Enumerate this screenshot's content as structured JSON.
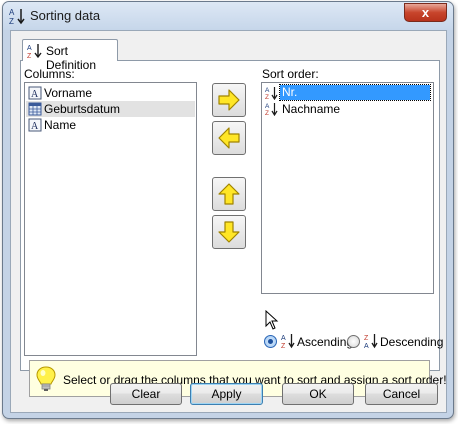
{
  "window": {
    "title": "Sorting data",
    "close_glyph": "x"
  },
  "tab": {
    "label": "Sort Definition"
  },
  "columns": {
    "label": "Columns:",
    "items": [
      {
        "label": "Vorname",
        "icon": "text-field-icon"
      },
      {
        "label": "Geburtsdatum",
        "icon": "date-field-icon"
      },
      {
        "label": "Name",
        "icon": "text-field-icon"
      }
    ]
  },
  "sort_order": {
    "label": "Sort order:",
    "items": [
      {
        "label": "Nr.",
        "icon": "sort-ascending-icon",
        "selected": true
      },
      {
        "label": "Nachname",
        "icon": "sort-ascending-icon",
        "selected": false
      }
    ]
  },
  "direction": {
    "ascending_label": "Ascending",
    "descending_label": "Descending",
    "selected": "Ascending"
  },
  "hint": {
    "text": "Select or drag the columns that you want to sort and assign a sort order!"
  },
  "buttons": {
    "clear": "Clear",
    "apply": "Apply",
    "ok": "OK",
    "cancel": "Cancel"
  },
  "colors": {
    "arrow_fill": "#ffe626",
    "arrow_stroke": "#a08400",
    "selection": "#3399ff",
    "hint_background": "#ffffe1"
  }
}
